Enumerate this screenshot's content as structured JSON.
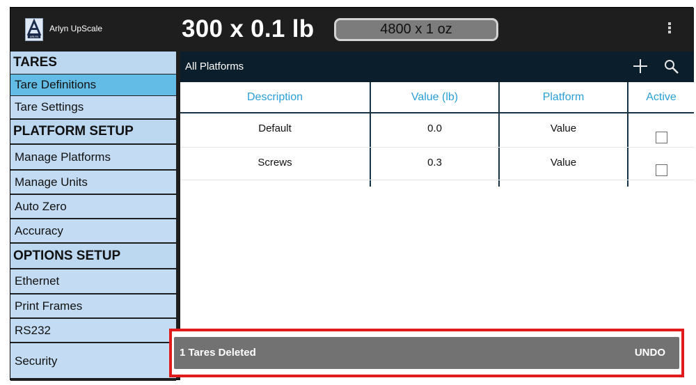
{
  "app": {
    "name": "Arlyn UpScale",
    "logo_text": "ARLYN"
  },
  "readout": {
    "primary": "300 x 0.1 lb",
    "secondary": "4800 x 1 oz"
  },
  "sidebar": {
    "items": [
      {
        "label": "TARES",
        "type": "header"
      },
      {
        "label": "Tare Definitions",
        "type": "item",
        "selected": true
      },
      {
        "label": "Tare Settings",
        "type": "item"
      },
      {
        "label": "PLATFORM SETUP",
        "type": "header"
      },
      {
        "label": "Manage Platforms",
        "type": "item"
      },
      {
        "label": "Manage Units",
        "type": "item"
      },
      {
        "label": "Auto Zero",
        "type": "item"
      },
      {
        "label": "Accuracy",
        "type": "item"
      },
      {
        "label": "OPTIONS SETUP",
        "type": "header"
      },
      {
        "label": "Ethernet",
        "type": "item"
      },
      {
        "label": "Print Frames",
        "type": "item"
      },
      {
        "label": "RS232",
        "type": "item"
      },
      {
        "label": "Security",
        "type": "item"
      }
    ]
  },
  "content": {
    "title": "All Platforms",
    "icons": [
      "plus-icon",
      "search-icon"
    ],
    "columns": [
      "Description",
      "Value (lb)",
      "Platform",
      "Active"
    ],
    "rows": [
      {
        "description": "Default",
        "value": "0.0",
        "platform": "Value",
        "active": false
      },
      {
        "description": "Screws",
        "value": "0.3",
        "platform": "Value",
        "active": false
      }
    ]
  },
  "toast": {
    "message": "1 Tares Deleted",
    "action": "UNDO"
  },
  "colors": {
    "accent": "#2a9fd6",
    "sidebar_bg": "#c3dcf3",
    "sidebar_selected": "#62bce5",
    "header_bar": "#0b1e2c",
    "highlight_border": "#e11b1b"
  }
}
